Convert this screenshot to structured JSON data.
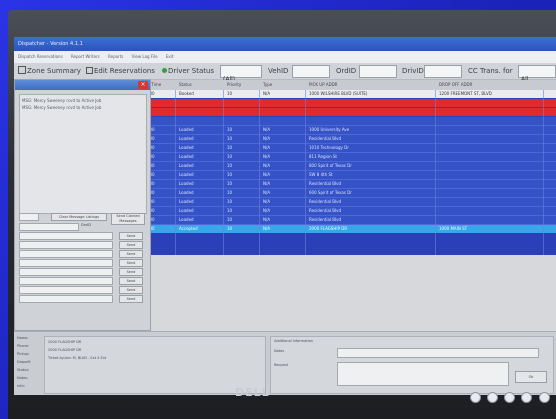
{
  "window": {
    "title": "Dispatcher - Version 4.1.1"
  },
  "menubar": {
    "items": [
      "Dispatch Reservations",
      "Report Writers",
      "Reports",
      "View Log File",
      "Exit"
    ]
  },
  "toolbar": {
    "zone_summary_label": "Zone Summary",
    "edit_reservations_label": "Edit Reservations",
    "driver_status_label": "Driver Status",
    "driver_status_value": "(All)",
    "vehid_label": "VehID",
    "ordid_label": "OrdID",
    "drivid_label": "DrivID",
    "cc_trans_label": "CC Trans. for",
    "cc_trans_value": "All"
  },
  "grid": {
    "columns": [
      "Res Time",
      "Status",
      "Priority",
      "Type",
      "PICK UP ADDR",
      "DROP OFF ADDR"
    ],
    "rows": [
      {
        "style": "white",
        "cells": [
          "10:00",
          "Booked",
          "10",
          "N/A",
          "1000 WILSHIRE BLVD (SUITE)",
          "1200 FREEMONT ST, BLVD"
        ]
      },
      {
        "style": "red",
        "cells": [
          "",
          "",
          "",
          "",
          "",
          ""
        ]
      },
      {
        "style": "red",
        "cells": [
          "",
          "",
          "",
          "",
          "",
          ""
        ]
      },
      {
        "style": "blue",
        "cells": [
          "",
          "",
          "",
          "",
          "",
          ""
        ]
      },
      {
        "style": "blue",
        "cells": [
          "10:00",
          "Loaded",
          "10",
          "N/A",
          "1000 University Ave",
          ""
        ]
      },
      {
        "style": "blue",
        "cells": [
          "10:00",
          "Loaded",
          "10",
          "N/A",
          "Residential Blvd",
          ""
        ]
      },
      {
        "style": "blue",
        "cells": [
          "10:00",
          "Loaded",
          "10",
          "N/A",
          "1010 Technology Dr",
          ""
        ]
      },
      {
        "style": "blue",
        "cells": [
          "10:00",
          "Loaded",
          "10",
          "N/A",
          "811 Region St",
          ""
        ]
      },
      {
        "style": "blue",
        "cells": [
          "10:00",
          "Loaded",
          "10",
          "N/A",
          "800 Spirit of Texas Dr",
          ""
        ]
      },
      {
        "style": "blue",
        "cells": [
          "10:00",
          "Loaded",
          "10",
          "N/A",
          "SW 8 4th St",
          ""
        ]
      },
      {
        "style": "blue",
        "cells": [
          "10:00",
          "Loaded",
          "10",
          "N/A",
          "Residential Blvd",
          ""
        ]
      },
      {
        "style": "blue",
        "cells": [
          "10:00",
          "Loaded",
          "10",
          "N/A",
          "600 Spirit of Texas Dr",
          ""
        ]
      },
      {
        "style": "blue",
        "cells": [
          "10:00",
          "Loaded",
          "10",
          "N/A",
          "Residential Blvd",
          ""
        ]
      },
      {
        "style": "blue",
        "cells": [
          "10:00",
          "Loaded",
          "10",
          "N/A",
          "Residential Blvd",
          ""
        ]
      },
      {
        "style": "blue",
        "cells": [
          "10:00",
          "Loaded",
          "10",
          "N/A",
          "Residential Blvd",
          ""
        ]
      },
      {
        "style": "sel",
        "cells": [
          "10:00",
          "Accepted",
          "10",
          "N/A",
          "2000 FLAGSHIP DR",
          "1000 MAIN ST"
        ]
      }
    ]
  },
  "messages_panel": {
    "lines": [
      "MSG: Mercy Sweeney rcvd to Active Job",
      "MSG: Mercy Sweeney rcvd to Active Job"
    ],
    "clear_button": "Clear Message Listings",
    "send_canned_label": "Send Canned Messages",
    "send_label": "Send",
    "send_all_label": "Send",
    "drivid_label": "DrvID",
    "send_buttons": [
      "Send",
      "Send",
      "Send",
      "Send",
      "Send",
      "Send",
      "Send",
      "Send"
    ]
  },
  "lower_panel": {
    "labels": [
      "Name:",
      "Phone:",
      "Pickup:",
      "Dropoff:",
      "Status:",
      "Notes:",
      "Info:"
    ],
    "values": [
      "2000 FLAGSHIP DR",
      "2000 FLAGSHIP DR",
      "Ticket by:Ann M, BLVD - Ext 4 Ext"
    ],
    "additional_info_label": "Additional Information",
    "notes_label": "Notes",
    "request_label": "Request",
    "ok_label": "Ok"
  },
  "monitor": {
    "brand": "DELL"
  },
  "colors": {
    "slide_bg": "#1f2bc9",
    "row_blue": "#3552c6",
    "row_red": "#e02a2f",
    "row_selected": "#39a6ea"
  }
}
